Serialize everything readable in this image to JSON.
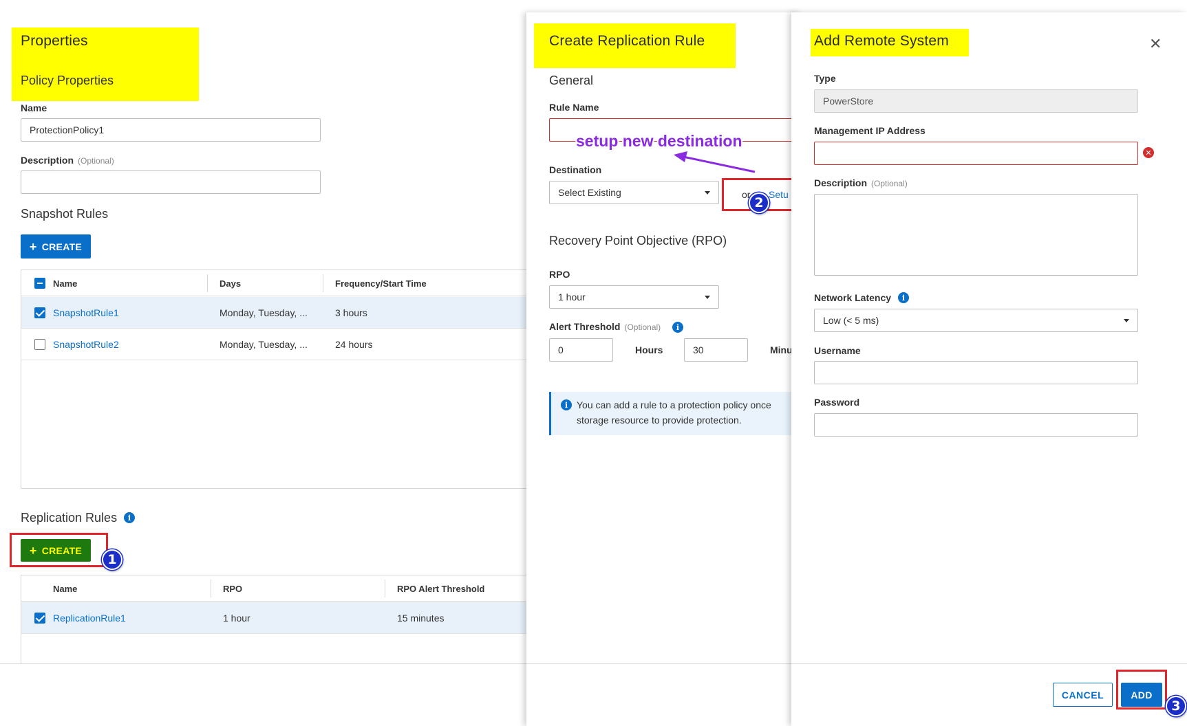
{
  "properties": {
    "title": "Properties",
    "subtitle": "Policy Properties",
    "name_label": "Name",
    "name_value": "ProtectionPolicy1",
    "description_label": "Description",
    "optional": "(Optional)",
    "description_value": ""
  },
  "snapshot_rules": {
    "title": "Snapshot Rules",
    "create_label": "CREATE",
    "columns": [
      "Name",
      "Days",
      "Frequency/Start Time"
    ],
    "rows": [
      {
        "name": "SnapshotRule1",
        "days": "Monday, Tuesday, ...",
        "frequency": "3 hours",
        "checked": true
      },
      {
        "name": "SnapshotRule2",
        "days": "Monday, Tuesday, ...",
        "frequency": "24 hours",
        "checked": false
      }
    ]
  },
  "replication_rules": {
    "title": "Replication Rules",
    "create_label": "CREATE",
    "columns": [
      "Name",
      "RPO",
      "RPO Alert Threshold"
    ],
    "rows": [
      {
        "name": "ReplicationRule1",
        "rpo": "1 hour",
        "threshold": "15 minutes",
        "checked": true
      }
    ]
  },
  "create_rule": {
    "title": "Create Replication Rule",
    "general": "General",
    "rule_name_label": "Rule Name",
    "rule_name_value": "",
    "destination_label": "Destination",
    "destination_value": "Select Existing",
    "or_text": "or",
    "setup_link": "Setu",
    "rpo_section": "Recovery Point Objective (RPO)",
    "rpo_label": "RPO",
    "rpo_value": "1 hour",
    "alert_label": "Alert Threshold",
    "optional": "(Optional)",
    "hours_value": "0",
    "hours_label": "Hours",
    "minutes_value": "30",
    "minutes_label": "Minu",
    "info_line1": "You can add a rule to a protection policy once",
    "info_line2": "storage resource to provide protection."
  },
  "remote_system": {
    "title": "Add Remote System",
    "type_label": "Type",
    "type_value": "PowerStore",
    "ip_label": "Management IP Address",
    "ip_value": "",
    "description_label": "Description",
    "optional": "(Optional)",
    "latency_label": "Network Latency",
    "latency_value": "Low (< 5 ms)",
    "username_label": "Username",
    "password_label": "Password",
    "cancel_label": "CANCEL",
    "add_label": "ADD"
  },
  "annotations": {
    "callout_text": "setup new destination",
    "step1": "1",
    "step2": "2",
    "step3": "3"
  },
  "colors": {
    "accent": "#0a6fc9",
    "highlight": "#ffff00",
    "error": "#d42d2d",
    "annotation_red": "#e0262c",
    "badge_blue": "#1b2fc8",
    "callout_purple": "#8a2be2",
    "create_green": "#1e7a0e"
  }
}
